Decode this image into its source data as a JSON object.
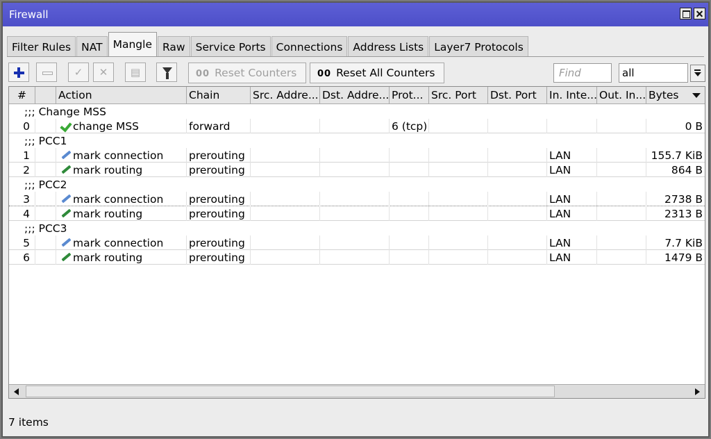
{
  "window": {
    "title": "Firewall"
  },
  "tabs": [
    "Filter Rules",
    "NAT",
    "Mangle",
    "Raw",
    "Service Ports",
    "Connections",
    "Address Lists",
    "Layer7 Protocols"
  ],
  "active_tab": "Mangle",
  "toolbar": {
    "reset_counters": "Reset Counters",
    "reset_all_counters": "Reset All Counters",
    "counter_glyph": "00",
    "find_placeholder": "Find",
    "filter_value": "all",
    "icons": [
      "add-icon",
      "remove-icon",
      "enable-icon",
      "disable-icon",
      "comment-icon",
      "filter-icon"
    ]
  },
  "table": {
    "columns": [
      "#",
      "",
      "Action",
      "Chain",
      "Src. Addre...",
      "Dst. Addre...",
      "Prot...",
      "Src. Port",
      "Dst. Port",
      "In. Inte...",
      "Out. In...",
      "Bytes"
    ],
    "groups": [
      {
        "comment": ";;; Change MSS",
        "rows": [
          {
            "num": "0",
            "icon": "check-icon",
            "action": "change MSS",
            "chain": "forward",
            "src": "",
            "dst": "",
            "proto": "6 (tcp)",
            "sport": "",
            "dport": "",
            "in": "",
            "out": "",
            "bytes": "0 B"
          }
        ]
      },
      {
        "comment": ";;; PCC1",
        "rows": [
          {
            "num": "1",
            "icon": "pen-blue-icon",
            "action": "mark connection",
            "chain": "prerouting",
            "src": "",
            "dst": "",
            "proto": "",
            "sport": "",
            "dport": "",
            "in": "LAN",
            "out": "",
            "bytes": "155.7 KiB"
          },
          {
            "num": "2",
            "icon": "pen-green-icon",
            "action": "mark routing",
            "chain": "prerouting",
            "src": "",
            "dst": "",
            "proto": "",
            "sport": "",
            "dport": "",
            "in": "LAN",
            "out": "",
            "bytes": "864 B"
          }
        ]
      },
      {
        "comment": ";;; PCC2",
        "rows": [
          {
            "num": "3",
            "icon": "pen-blue-icon",
            "action": "mark connection",
            "chain": "prerouting",
            "src": "",
            "dst": "",
            "proto": "",
            "sport": "",
            "dport": "",
            "in": "LAN",
            "out": "",
            "bytes": "2738 B"
          },
          {
            "num": "4",
            "icon": "pen-green-icon",
            "action": "mark routing",
            "chain": "prerouting",
            "src": "",
            "dst": "",
            "proto": "",
            "sport": "",
            "dport": "",
            "in": "LAN",
            "out": "",
            "bytes": "2313 B"
          }
        ]
      },
      {
        "comment": ";;; PCC3",
        "rows": [
          {
            "num": "5",
            "icon": "pen-blue-icon",
            "action": "mark connection",
            "chain": "prerouting",
            "src": "",
            "dst": "",
            "proto": "",
            "sport": "",
            "dport": "",
            "in": "LAN",
            "out": "",
            "bytes": "7.7 KiB"
          },
          {
            "num": "6",
            "icon": "pen-green-icon",
            "action": "mark routing",
            "chain": "prerouting",
            "src": "",
            "dst": "",
            "proto": "",
            "sport": "",
            "dport": "",
            "in": "LAN",
            "out": "",
            "bytes": "1479 B"
          }
        ]
      }
    ]
  },
  "status": {
    "items": "7 items"
  },
  "colors": {
    "titlebar": "#5254cc",
    "accent_blue": "#1730b0",
    "check_green": "#3aa936"
  }
}
